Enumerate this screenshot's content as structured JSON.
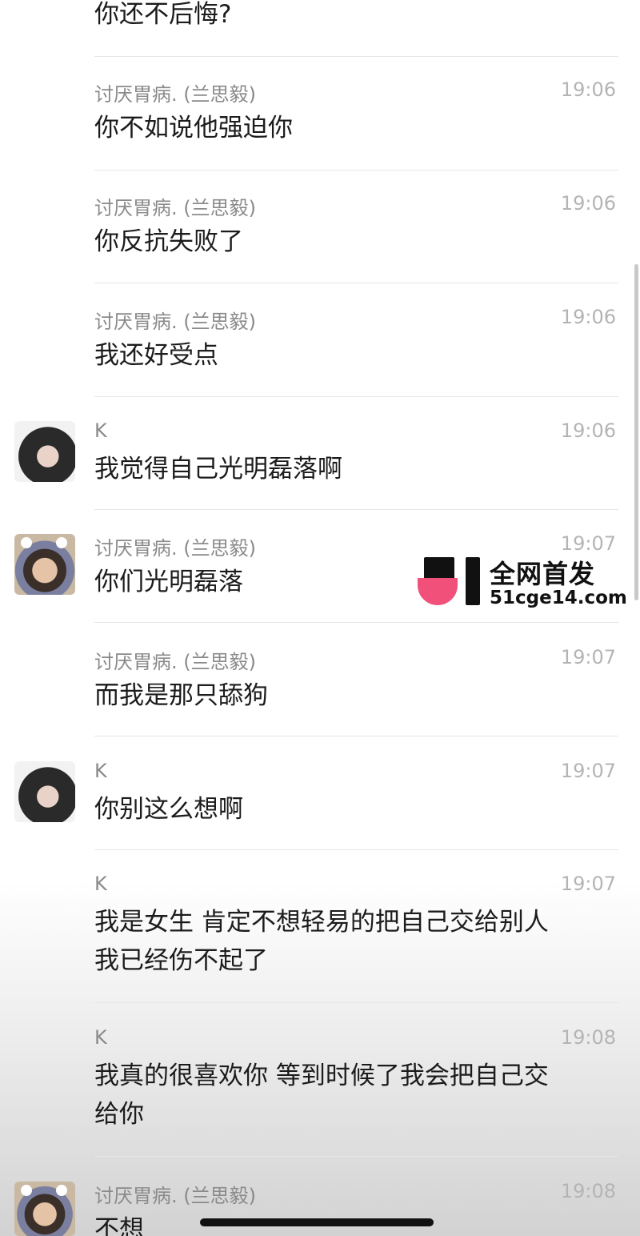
{
  "messages": [
    {
      "sender": "",
      "time": "",
      "text": "你还不后悔?",
      "avatar": "none"
    },
    {
      "sender": "讨厌胃病. (兰思毅)",
      "time": "19:06",
      "text": "你不如说他强迫你",
      "avatar": "none"
    },
    {
      "sender": "讨厌胃病. (兰思毅)",
      "time": "19:06",
      "text": "你反抗失败了",
      "avatar": "none"
    },
    {
      "sender": "讨厌胃病. (兰思毅)",
      "time": "19:06",
      "text": "我还好受点",
      "avatar": "none"
    },
    {
      "sender": "K",
      "time": "19:06",
      "text": "我觉得自己光明磊落啊",
      "avatar": "k"
    },
    {
      "sender": "讨厌胃病. (兰思毅)",
      "time": "19:07",
      "text": "你们光明磊落",
      "avatar": "boy"
    },
    {
      "sender": "讨厌胃病. (兰思毅)",
      "time": "19:07",
      "text": "而我是那只舔狗",
      "avatar": "none"
    },
    {
      "sender": "K",
      "time": "19:07",
      "text": "你别这么想啊",
      "avatar": "k"
    },
    {
      "sender": "K",
      "time": "19:07",
      "text": "我是女生 肯定不想轻易的把自己交给别人\n我已经伤不起了",
      "avatar": "none"
    },
    {
      "sender": "K",
      "time": "19:08",
      "text": "我真的很喜欢你 等到时候了我会把自己交\n给你",
      "avatar": "none"
    },
    {
      "sender": "讨厌胃病. (兰思毅)",
      "time": "19:08",
      "text": "不想",
      "avatar": "boy"
    }
  ],
  "watermark": {
    "title": "全网首发",
    "url": "51cge14.com",
    "accent_color": "#f0507a"
  },
  "colors": {
    "name": "#8a8a8a",
    "time": "#b4b4b4",
    "text": "#1c1c1c",
    "divider": "#e6e6e6"
  }
}
